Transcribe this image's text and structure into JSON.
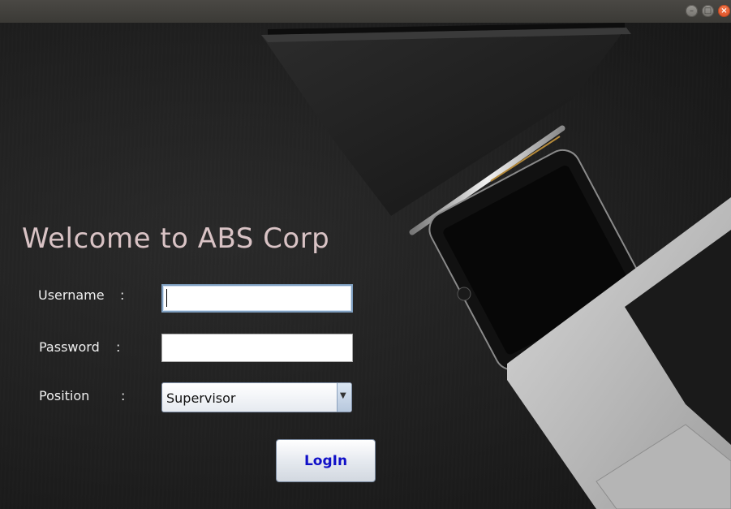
{
  "window": {
    "min_icon": "minimize-icon",
    "max_icon": "maximize-icon",
    "close_icon": "close-icon",
    "close_glyph": "×"
  },
  "heading": "Welcome to ABS Corp",
  "form": {
    "username_label": "Username",
    "password_label": "Password",
    "position_label": "Position",
    "colon": ":",
    "username_value": "",
    "password_value": "",
    "position_selected": "Supervisor",
    "dropdown_glyph": "▼",
    "login_label": "LogIn"
  },
  "colors": {
    "heading": "#d9c3c5",
    "button_text": "#1010c8",
    "close_button": "#e0542a"
  }
}
